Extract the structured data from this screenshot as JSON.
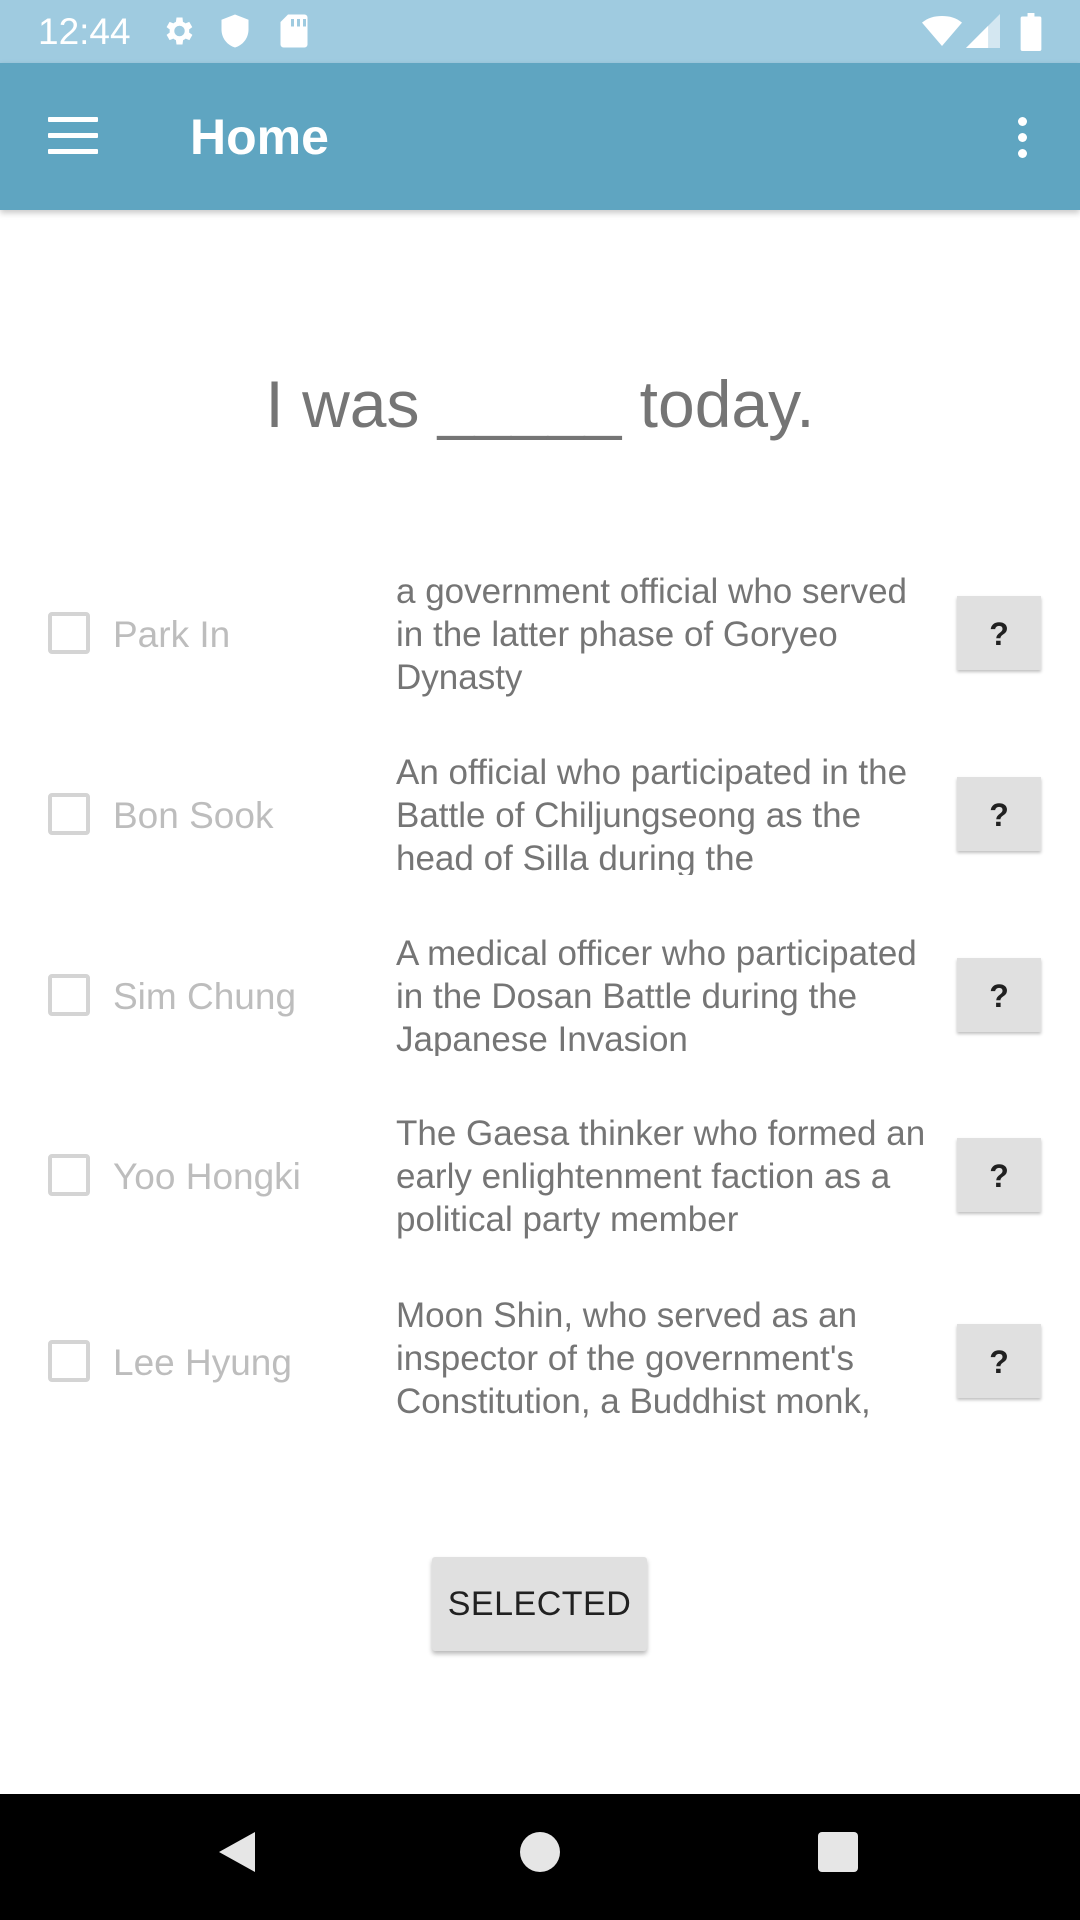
{
  "status_bar": {
    "time": "12:44",
    "left_icons": [
      "gear-icon",
      "shield-icon",
      "sd-card-icon"
    ],
    "right_icons": [
      "wifi-icon",
      "cell-signal-icon",
      "battery-icon"
    ]
  },
  "app_bar": {
    "title": "Home",
    "color": "#5fa5c1",
    "icons": [
      "menu-icon",
      "overflow-menu-icon"
    ]
  },
  "question": "I was _____ today.",
  "options": [
    {
      "name": "Park In",
      "description": "a government official who served in the latter phase of Goryeo Dynasty",
      "help_label": "?",
      "checked": false
    },
    {
      "name": "Bon Sook",
      "description": "An official who participated in the Battle of Chiljungseong as the head of Silla during the",
      "help_label": "?",
      "checked": false
    },
    {
      "name": "Sim Chung",
      "description": "A medical officer who participated in the Dosan Battle during the Japanese Invasion",
      "help_label": "?",
      "checked": false
    },
    {
      "name": "Yoo Hongki",
      "description": "The Gaesa thinker who formed an early enlightenment faction as a political party member",
      "help_label": "?",
      "checked": false
    },
    {
      "name": "Lee Hyung",
      "description": "Moon Shin, who served as an inspector of the government's Constitution, a Buddhist monk,",
      "help_label": "?",
      "checked": false
    }
  ],
  "submit_label": "SELECTED",
  "nav_bar": {
    "icons": [
      "back-icon",
      "home-icon",
      "recents-icon"
    ]
  }
}
